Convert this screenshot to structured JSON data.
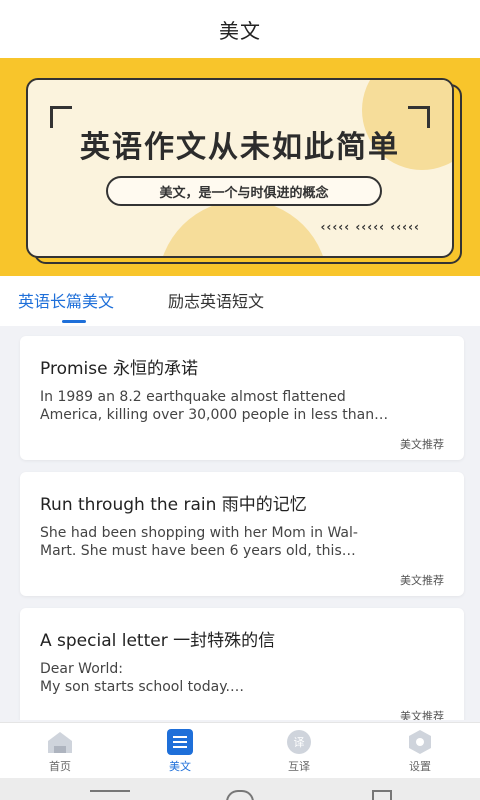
{
  "header": {
    "title": "美文"
  },
  "banner": {
    "headline": "英语作文从未如此简单",
    "pill": "美文，是一个与时俱进的概念",
    "arrows": "‹‹‹‹‹   ‹‹‹‹‹   ‹‹‹‹‹"
  },
  "tabs": [
    {
      "label": "英语长篇美文",
      "active": true
    },
    {
      "label": "励志英语短文",
      "active": false
    }
  ],
  "articles": [
    {
      "title": "Promise 永恒的承诺",
      "excerpt": "      In 1989 an 8.2 earthquake almost flattened\nAmerica, killing over 30,000 people in less than…",
      "tag": "美文推荐"
    },
    {
      "title": "Run through the rain 雨中的记忆",
      "excerpt": "      She had been shopping with her Mom in Wal-\nMart. She must have been 6 years old, this…",
      "tag": "美文推荐"
    },
    {
      "title": "A special letter 一封特殊的信",
      "excerpt": "Dear World:\n      My son starts school today.…",
      "tag": "美文推荐"
    }
  ],
  "bottom_nav": [
    {
      "label": "首页",
      "icon": "home-icon",
      "active": false
    },
    {
      "label": "美文",
      "icon": "article-list-icon",
      "active": true
    },
    {
      "label": "互译",
      "icon": "translate-icon",
      "active": false
    },
    {
      "label": "设置",
      "icon": "settings-icon",
      "active": false
    }
  ],
  "colors": {
    "accent": "#1e6fd9",
    "banner": "#f8c52b",
    "background": "#f1f2f6"
  }
}
